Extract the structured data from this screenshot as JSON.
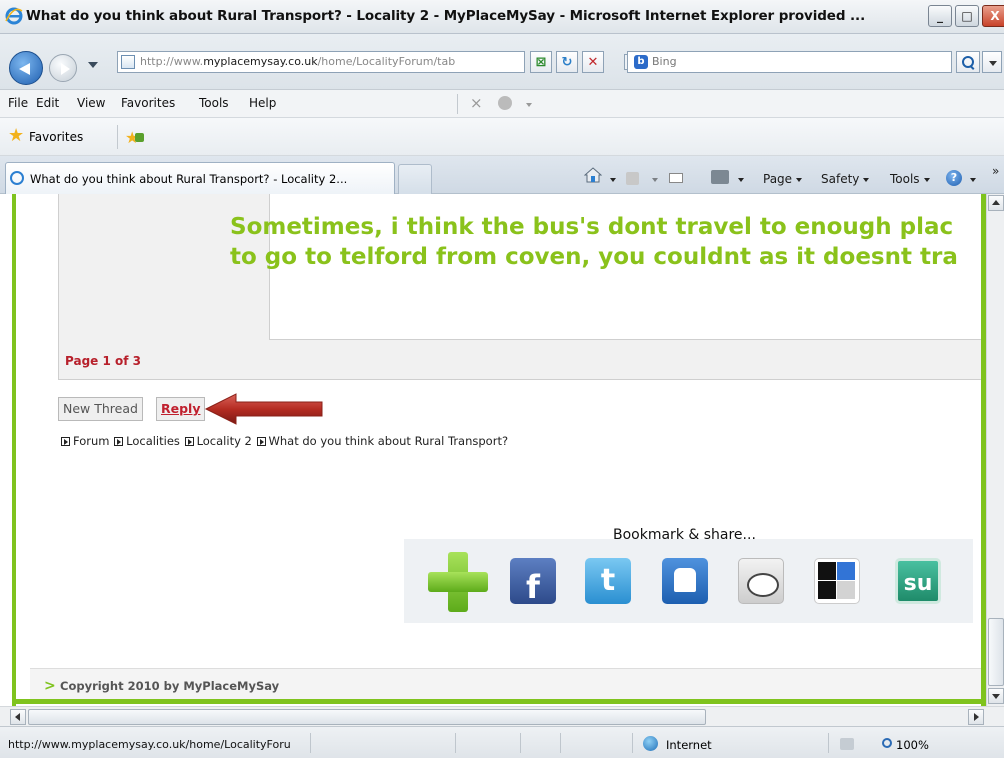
{
  "window": {
    "title": "What do you think about Rural Transport? - Locality 2 - MyPlaceMySay - Microsoft Internet Explorer provided ...",
    "min_glyph": "_",
    "max_glyph": "□",
    "close_glyph": "X"
  },
  "address_bar": {
    "url_prefix": "http://www.",
    "url_domain": "myplacemysay.co.uk",
    "url_suffix": "/home/LocalityForum/tab",
    "search_engine": "Bing"
  },
  "menu": {
    "items": [
      "File",
      "Edit",
      "View",
      "Favorites",
      "Tools",
      "Help"
    ]
  },
  "favorites_bar": {
    "label": "Favorites"
  },
  "tab": {
    "label": "What do you think about Rural Transport? - Locality 2..."
  },
  "command_bar": {
    "page": "Page",
    "safety": "Safety",
    "tools": "Tools",
    "more": "»"
  },
  "post": {
    "line1": "Sometimes, i think the bus's dont travel to enough plac",
    "line2": "to go to telford from coven, you couldnt as it doesnt tra",
    "text_color": "#8ac21b"
  },
  "pagination": {
    "label": "Page 1 of 3"
  },
  "actions": {
    "new_thread": "New Thread",
    "reply": "Reply"
  },
  "breadcrumb": {
    "items": [
      "Forum",
      "Localities",
      "Locality 2",
      "What do you think about Rural Transport?"
    ]
  },
  "share": {
    "title": "Bookmark & share...",
    "icons": [
      "add-icon",
      "facebook-icon",
      "twitter-icon",
      "myspace-icon",
      "reddit-icon",
      "delicious-icon",
      "stumbleupon-icon"
    ],
    "facebook_glyph": "f",
    "twitter_glyph": "t",
    "stumbleupon_glyph": "su"
  },
  "footer": {
    "arrow": ">",
    "text": "Copyright 2010 by MyPlaceMySay"
  },
  "status_bar": {
    "url": "http://www.myplacemysay.co.uk/home/LocalityForu",
    "zone": "Internet",
    "zoom": "100%"
  },
  "colors": {
    "brand_green": "#7fc31e",
    "accent_red": "#b7202b",
    "annotation_arrow": "#b52c22"
  }
}
